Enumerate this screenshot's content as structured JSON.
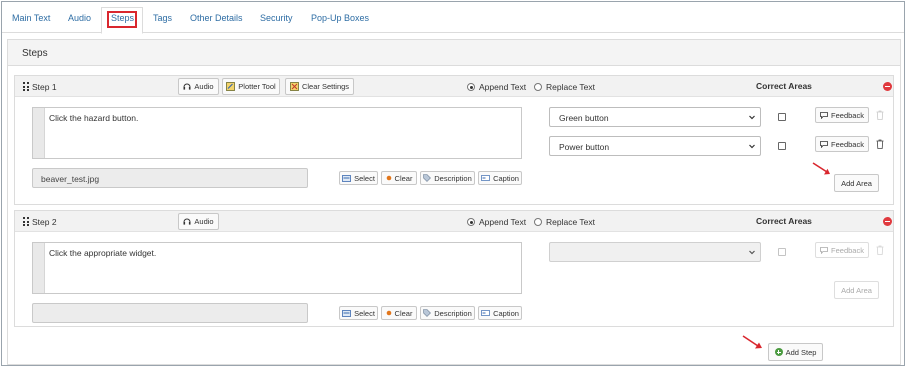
{
  "tabs": [
    {
      "label": "Main Text"
    },
    {
      "label": "Audio"
    },
    {
      "label": "Steps"
    },
    {
      "label": "Tags"
    },
    {
      "label": "Other Details"
    },
    {
      "label": "Security"
    },
    {
      "label": "Pop-Up Boxes"
    }
  ],
  "active_tab": "Steps",
  "section": {
    "title": "Steps"
  },
  "steps": [
    {
      "title": "Step 1",
      "buttons": {
        "audio": "Audio",
        "plotter": "Plotter Tool",
        "clear_settings": "Clear Settings"
      },
      "text_mode": {
        "append": "Append Text",
        "replace": "Replace Text",
        "selected": "append"
      },
      "correct_areas_label": "Correct Areas",
      "text": "Click the hazard button.",
      "file": "beaver_test.jpg",
      "media_buttons": {
        "select": "Select",
        "clear": "Clear",
        "description": "Description",
        "caption": "Caption"
      },
      "areas": [
        {
          "value": "Green button",
          "checked": false,
          "feedback": "Feedback"
        },
        {
          "value": "Power button",
          "checked": false,
          "feedback": "Feedback"
        }
      ],
      "add_area": "Add Area"
    },
    {
      "title": "Step 2",
      "buttons": {
        "audio": "Audio"
      },
      "text_mode": {
        "append": "Append Text",
        "replace": "Replace Text",
        "selected": "append"
      },
      "correct_areas_label": "Correct Areas",
      "text": "Click the appropriate widget.",
      "file": "",
      "media_buttons": {
        "select": "Select",
        "clear": "Clear",
        "description": "Description",
        "caption": "Caption"
      },
      "areas": [
        {
          "value": "",
          "checked": false,
          "feedback": "Feedback"
        }
      ],
      "add_area": "Add Area"
    }
  ],
  "add_step": "Add Step",
  "colors": {
    "accent": "#2e6da4",
    "highlight": "#d9272e",
    "remove": "#e0393e",
    "add": "#4a9a3f"
  }
}
